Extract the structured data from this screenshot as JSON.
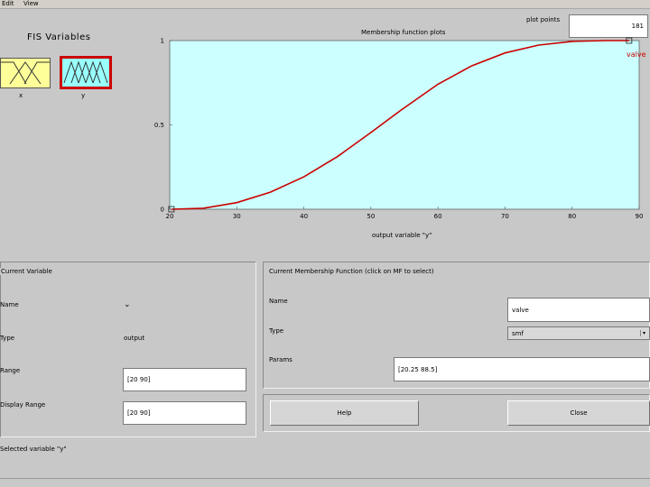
{
  "menu": {
    "edit": "Edit",
    "view": "View"
  },
  "fis_panel": {
    "title": "FIS Variables",
    "variables": [
      {
        "label": "x",
        "selected": false,
        "color": "#ffff99"
      },
      {
        "label": "y",
        "selected": true,
        "color": "#99ffff"
      }
    ]
  },
  "plot_points": {
    "label": "plot points",
    "value": "181"
  },
  "plot": {
    "title": "Membership function plots",
    "mf_label": "valve",
    "xlabel": "output variable \"y\""
  },
  "chart_data": {
    "type": "line",
    "title": "Membership function plots",
    "xlabel": "output variable \"y\"",
    "xlim": [
      20,
      90
    ],
    "ylim": [
      0,
      1
    ],
    "xticks": [
      "20",
      "30",
      "40",
      "50",
      "60",
      "70",
      "80",
      "90"
    ],
    "yticks": [
      "0",
      "0.5",
      "1"
    ],
    "background": "#ccffff",
    "line_color": "#cc0000",
    "series": [
      {
        "name": "valve",
        "x": [
          20.25,
          25,
          30,
          35,
          40,
          45,
          50,
          54.4,
          60,
          65,
          70,
          75,
          80,
          85,
          88.5
        ],
        "y": [
          0,
          0.006,
          0.039,
          0.101,
          0.192,
          0.312,
          0.455,
          0.585,
          0.741,
          0.85,
          0.927,
          0.973,
          0.995,
          1.0,
          1.0
        ]
      }
    ]
  },
  "current_variable": {
    "title": "Current Variable",
    "name_label": "Name",
    "type_label": "Type",
    "type_value": "output",
    "range_label": "Range",
    "range_value": "[20 90]",
    "display_range_label": "Display Range",
    "display_range_value": "[20 90]"
  },
  "current_mf": {
    "title": "Current Membership Function (click on MF to select)",
    "name_label": "Name",
    "name_value": "valve",
    "type_label": "Type",
    "type_value": "smf",
    "params_label": "Params",
    "params_value": "[20.25 88.5]"
  },
  "buttons": {
    "help": "Help",
    "close": "Close"
  },
  "status": "Selected variable \"y\""
}
